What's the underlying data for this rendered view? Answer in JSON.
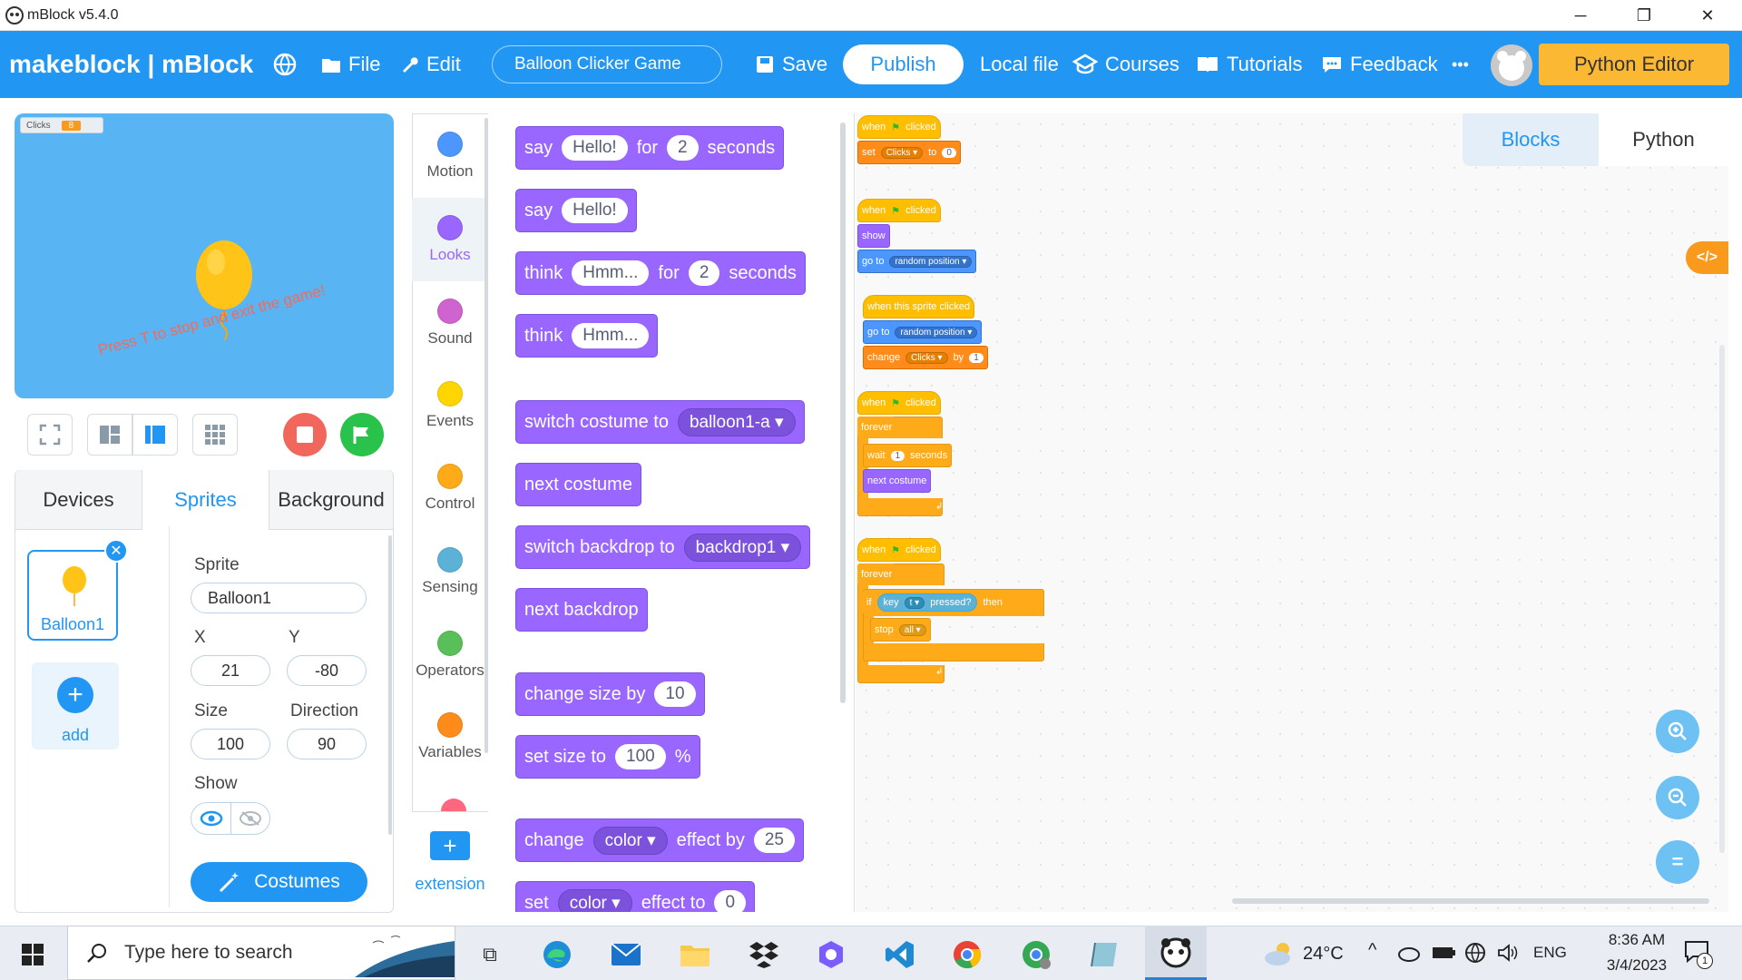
{
  "window": {
    "title": "mBlock v5.4.0",
    "min": "─",
    "restore": "❐",
    "close": "✕"
  },
  "menubar": {
    "brand": "makeblock | mBlock",
    "file": "File",
    "edit": "Edit",
    "project_name": "Balloon Clicker Game",
    "save": "Save",
    "publish": "Publish",
    "local_file": "Local file",
    "courses": "Courses",
    "tutorials": "Tutorials",
    "feedback": "Feedback",
    "more": "•••",
    "python_editor": "Python Editor"
  },
  "stage": {
    "monitor_label": "Clicks",
    "monitor_value": "8",
    "message": "Press T to stop and exit the game!"
  },
  "sprite_panel": {
    "tabs": [
      "Devices",
      "Sprites",
      "Background"
    ],
    "sprite_name": "Balloon1",
    "add_label": "add",
    "sprite_label": "Sprite",
    "sprite_value": "Balloon1",
    "x_label": "X",
    "x_value": "21",
    "y_label": "Y",
    "y_value": "-80",
    "size_label": "Size",
    "size_value": "100",
    "direction_label": "Direction",
    "direction_value": "90",
    "show_label": "Show",
    "costumes_label": "Costumes"
  },
  "categories": [
    {
      "label": "Motion",
      "color": "#4c97ff"
    },
    {
      "label": "Looks",
      "color": "#9966ff"
    },
    {
      "label": "Sound",
      "color": "#cf63cf"
    },
    {
      "label": "Events",
      "color": "#ffd500"
    },
    {
      "label": "Control",
      "color": "#ffab19"
    },
    {
      "label": "Sensing",
      "color": "#5cb1d6"
    },
    {
      "label": "Operators",
      "color": "#59c059"
    },
    {
      "label": "Variables",
      "color": "#ff8c1a"
    }
  ],
  "extension_label": "extension",
  "palette": {
    "b1": {
      "a": "say",
      "b": "Hello!",
      "c": "for",
      "d": "2",
      "e": "seconds"
    },
    "b2": {
      "a": "say",
      "b": "Hello!"
    },
    "b3": {
      "a": "think",
      "b": "Hmm...",
      "c": "for",
      "d": "2",
      "e": "seconds"
    },
    "b4": {
      "a": "think",
      "b": "Hmm..."
    },
    "b5": {
      "a": "switch costume to",
      "b": "balloon1-a ▾"
    },
    "b6": {
      "a": "next costume"
    },
    "b7": {
      "a": "switch backdrop to",
      "b": "backdrop1 ▾"
    },
    "b8": {
      "a": "next backdrop"
    },
    "b9": {
      "a": "change size by",
      "b": "10"
    },
    "b10": {
      "a": "set size to",
      "b": "100",
      "c": "%"
    },
    "b11": {
      "a": "change",
      "b": "color ▾",
      "c": "effect by",
      "d": "25"
    },
    "b12": {
      "a": "set",
      "b": "color ▾",
      "c": "effect to",
      "d": "0"
    }
  },
  "code": {
    "when": "when",
    "clicked": "clicked",
    "set": "set",
    "clicks_var": "Clicks ▾",
    "to": "to",
    "zero": "0",
    "show": "show",
    "go_to": "go to",
    "random_position": "random position ▾",
    "when_sprite_clicked": "when this sprite clicked",
    "change": "change",
    "by": "by",
    "one": "1",
    "forever": "forever",
    "wait": "wait",
    "seconds": "seconds",
    "next_costume": "next costume",
    "if": "if",
    "key": "key",
    "key_t": "t ▾",
    "pressed": "pressed?",
    "then": "then",
    "stop": "stop",
    "all": "all ▾"
  },
  "code_tabs": {
    "blocks": "Blocks",
    "python": "Python"
  },
  "taskbar": {
    "search_placeholder": "Type here to search",
    "weather": "24°C",
    "lang": "ENG",
    "time": "8:36 AM",
    "date": "3/4/2023",
    "notif": "1"
  }
}
